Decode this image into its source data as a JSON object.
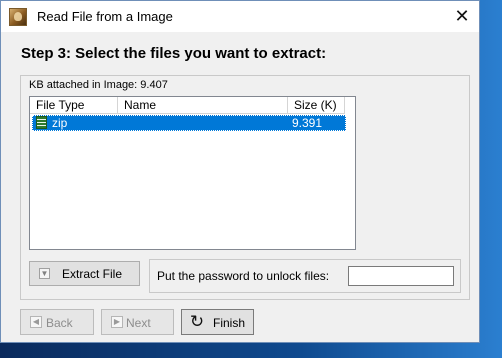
{
  "window": {
    "title": "Read File from a Image",
    "app_icon": "app-logo-icon",
    "close_glyph": "✕"
  },
  "heading": "Step 3: Select the files you want to extract:",
  "kb_attached": "KB attached in Image: 9.407",
  "file_list": {
    "columns": [
      "File Type",
      "Name",
      "Size (K)"
    ],
    "rows": [
      {
        "type": "zip",
        "name": "",
        "size": "9.391",
        "selected": true,
        "icon": "zip-file-icon"
      }
    ]
  },
  "actions": {
    "extract_label": "Extract File",
    "extract_icon": "extract-icon"
  },
  "password": {
    "label": "Put the password to unlock files:",
    "value": ""
  },
  "nav": {
    "back_label": "Back",
    "next_label": "Next",
    "finish_label": "Finish",
    "back_icon": "back-arrow-icon",
    "next_icon": "next-arrow-icon",
    "finish_icon": "finish-icon"
  },
  "colors": {
    "selection": "#0078d7",
    "window_bg": "#f0f0f0"
  }
}
